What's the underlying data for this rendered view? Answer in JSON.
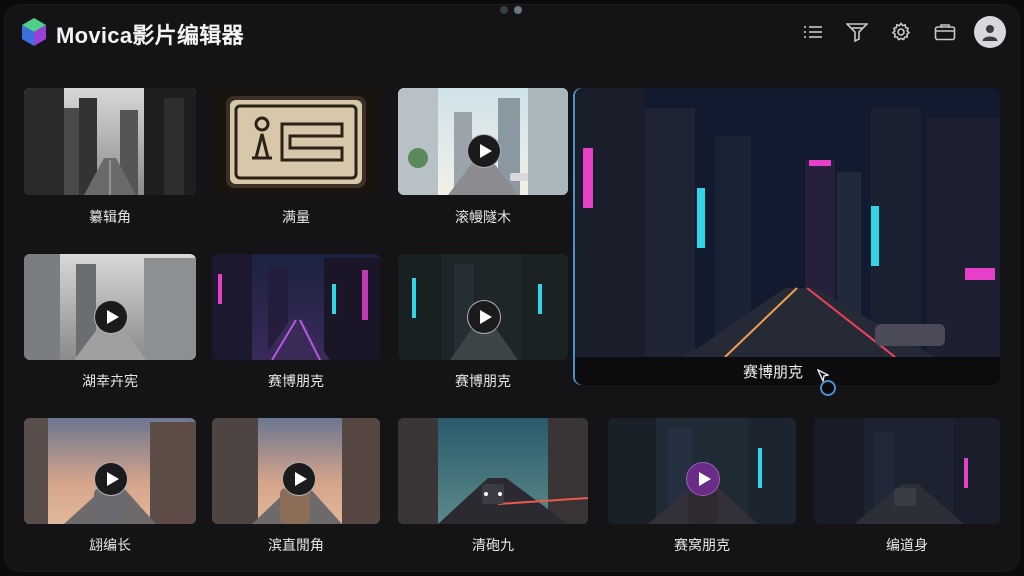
{
  "app": {
    "title": "Movica影片编辑器"
  },
  "header": {
    "icons": [
      "list-icon",
      "filter-icon",
      "gear-icon",
      "folder-icon",
      "user-icon"
    ]
  },
  "row1": [
    {
      "label": "纂辑角"
    },
    {
      "label": "满量"
    },
    {
      "label": "滚幔隧木"
    }
  ],
  "row2": [
    {
      "label": "湖幸卉宪"
    },
    {
      "label": "赛博朋克"
    },
    {
      "label": "赛博朋克"
    }
  ],
  "featured": {
    "label": "赛博朋克"
  },
  "row3": [
    {
      "label": "翃编长"
    },
    {
      "label": "滨直閒角"
    },
    {
      "label": "清砲九"
    },
    {
      "label": "赛窝朋克"
    },
    {
      "label": "编道身"
    }
  ],
  "colors": {
    "accent": "#4a8fd0",
    "play_highlight": "#6a2c86",
    "neon_pink": "#e83fc8",
    "neon_cyan": "#2fd6e6"
  }
}
